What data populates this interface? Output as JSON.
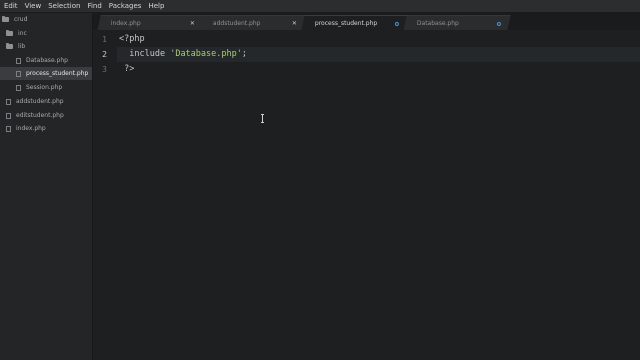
{
  "menu": [
    "Edit",
    "View",
    "Selection",
    "Find",
    "Packages",
    "Help"
  ],
  "tree": {
    "root": "crud",
    "items": [
      {
        "label": "inc",
        "kind": "folder"
      },
      {
        "label": "lib",
        "kind": "folder"
      },
      {
        "label": "Database.php",
        "kind": "file"
      },
      {
        "label": "process_student.php",
        "kind": "file",
        "selected": true
      },
      {
        "label": "Session.php",
        "kind": "file"
      },
      {
        "label": "addstudent.php",
        "kind": "file"
      },
      {
        "label": "editstudent.php",
        "kind": "file"
      },
      {
        "label": "index.php",
        "kind": "file"
      }
    ]
  },
  "tabs": [
    {
      "label": "index.php",
      "marker": "close"
    },
    {
      "label": "addstudent.php",
      "marker": "close"
    },
    {
      "label": "process_student.php",
      "marker": "modified",
      "active": true
    },
    {
      "label": "Database.php",
      "marker": "modified"
    }
  ],
  "editor": {
    "current_line": 2,
    "line_numbers": [
      "1",
      "2",
      "3"
    ],
    "lines": {
      "l1": "<?php",
      "l2_kw": "include",
      "l2_str": "'Database.php'",
      "l2_end": ";",
      "l3": "?>"
    }
  },
  "colors": {
    "background": "#1d1f21",
    "string": "#a6d06a",
    "modified_dot": "#4a90d9"
  }
}
